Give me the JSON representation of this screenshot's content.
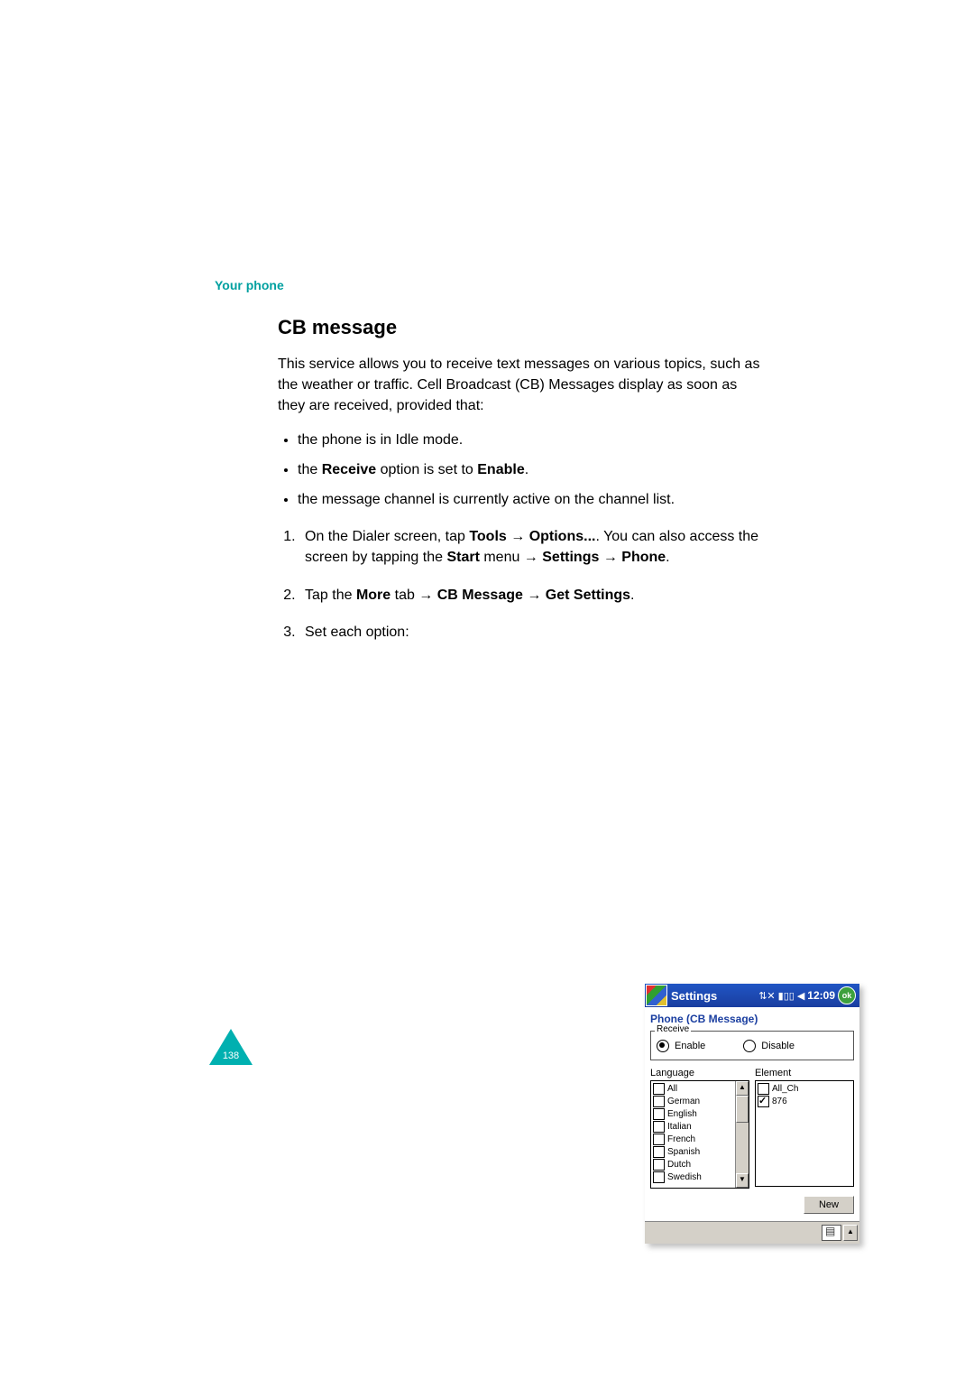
{
  "header": "Your phone",
  "heading": "CB message",
  "intro": "This service allows you to receive text messages on various topics, such as the weather or traffic. Cell Broadcast (CB) Messages display as soon as they are received, provided that:",
  "bullets": {
    "b1": "the phone is in Idle mode.",
    "b2_pre": "the ",
    "b2_bold1": "Receive",
    "b2_mid": " option is set to ",
    "b2_bold2": "Enable",
    "b2_end": ".",
    "b3": "the message channel is currently active on the channel list."
  },
  "steps": {
    "s1_pre": "On the Dialer screen, tap ",
    "s1_b1": "Tools",
    "s1_arrow1": " → ",
    "s1_b2": "Options...",
    "s1_mid": ". You can also access the screen by tapping the ",
    "s1_b3": "Start",
    "s1_mid2": " menu → ",
    "s1_b4": "Settings",
    "s1_arrow2": " → ",
    "s1_b5": "Phone",
    "s1_end": ".",
    "s2_pre": "Tap the ",
    "s2_b1": "More",
    "s2_mid1": " tab → ",
    "s2_b2": "CB Message",
    "s2_mid2": " → ",
    "s2_b3": "Get Settings",
    "s2_end": ".",
    "s3": "Set each option:"
  },
  "screenshot": {
    "title": "Settings",
    "time": "12:09",
    "ok": "ok",
    "subtitle": "Phone (CB Message)",
    "receive_legend": "Receive",
    "enable": "Enable",
    "disable": "Disable",
    "language_label": "Language",
    "element_label": "Element",
    "languages": [
      "All",
      "German",
      "English",
      "Italian",
      "French",
      "Spanish",
      "Dutch",
      "Swedish"
    ],
    "elements": [
      {
        "label": "All_Ch",
        "checked": false
      },
      {
        "label": "876",
        "checked": true
      }
    ],
    "new_button": "New"
  },
  "page_number": "138"
}
